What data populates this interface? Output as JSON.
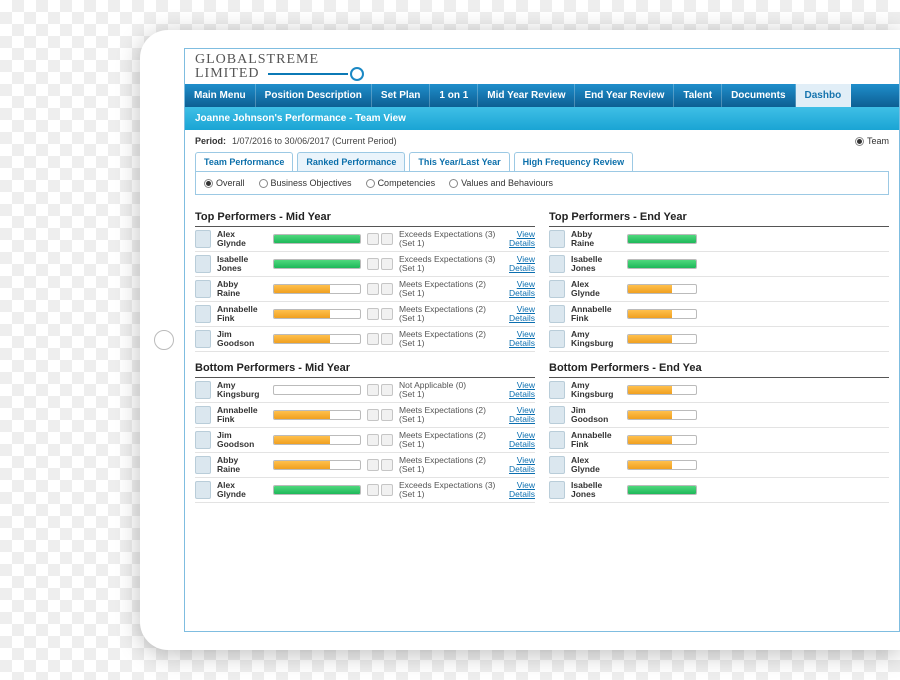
{
  "logo": {
    "line1": "GLOBALSTREME",
    "line2": "LIMITED"
  },
  "menu": [
    "Main Menu",
    "Position Description",
    "Set Plan",
    "1 on 1",
    "Mid Year Review",
    "End Year Review",
    "Talent",
    "Documents",
    "Dashbo"
  ],
  "subheader": "Joanne Johnson's Performance - Team View",
  "period": {
    "label": "Period:",
    "value": "1/07/2016 to 30/06/2017 (Current Period)",
    "team_label": "Team"
  },
  "tabs": [
    "Team Performance",
    "Ranked Performance",
    "This Year/Last Year",
    "High Frequency Review"
  ],
  "active_tab": 1,
  "filters": [
    "Overall",
    "Business Objectives",
    "Competencies",
    "Values and Behaviours"
  ],
  "active_filter": 0,
  "sections": {
    "top_mid": {
      "title": "Top Performers - Mid Year"
    },
    "top_end": {
      "title": "Top Performers - End Year"
    },
    "bot_mid": {
      "title": "Bottom Performers - Mid Year"
    },
    "bot_end": {
      "title": "Bottom Performers - End Yea"
    }
  },
  "view_label": "View",
  "details_label": "Details",
  "top_mid_rows": [
    {
      "name": "Alex Glynde",
      "color": "green",
      "pct": 100,
      "rating": "Exceeds Expectations (3) (Set 1)"
    },
    {
      "name": "Isabelle Jones",
      "color": "green",
      "pct": 100,
      "rating": "Exceeds Expectations (3) (Set 1)"
    },
    {
      "name": "Abby Raine",
      "color": "orange",
      "pct": 65,
      "rating": "Meets Expectations (2) (Set 1)"
    },
    {
      "name": "Annabelle Fink",
      "color": "orange",
      "pct": 65,
      "rating": "Meets Expectations (2) (Set 1)"
    },
    {
      "name": "Jim Goodson",
      "color": "orange",
      "pct": 65,
      "rating": "Meets Expectations (2) (Set 1)"
    }
  ],
  "top_end_rows": [
    {
      "name": "Abby Raine",
      "color": "green",
      "pct": 100
    },
    {
      "name": "Isabelle Jones",
      "color": "green",
      "pct": 100
    },
    {
      "name": "Alex Glynde",
      "color": "orange",
      "pct": 65
    },
    {
      "name": "Annabelle Fink",
      "color": "orange",
      "pct": 65
    },
    {
      "name": "Amy Kingsburg",
      "color": "orange",
      "pct": 65
    }
  ],
  "bot_mid_rows": [
    {
      "name": "Amy Kingsburg",
      "color": "none",
      "pct": 3,
      "rating": "Not Applicable (0) (Set 1)"
    },
    {
      "name": "Annabelle Fink",
      "color": "orange",
      "pct": 65,
      "rating": "Meets Expectations (2) (Set 1)"
    },
    {
      "name": "Jim Goodson",
      "color": "orange",
      "pct": 65,
      "rating": "Meets Expectations (2) (Set 1)"
    },
    {
      "name": "Abby Raine",
      "color": "orange",
      "pct": 65,
      "rating": "Meets Expectations (2) (Set 1)"
    },
    {
      "name": "Alex Glynde",
      "color": "green",
      "pct": 100,
      "rating": "Exceeds Expectations (3) (Set 1)"
    }
  ],
  "bot_end_rows": [
    {
      "name": "Amy Kingsburg",
      "color": "orange",
      "pct": 65
    },
    {
      "name": "Jim Goodson",
      "color": "orange",
      "pct": 65
    },
    {
      "name": "Annabelle Fink",
      "color": "orange",
      "pct": 65
    },
    {
      "name": "Alex Glynde",
      "color": "orange",
      "pct": 65
    },
    {
      "name": "Isabelle Jones",
      "color": "green",
      "pct": 100
    }
  ]
}
